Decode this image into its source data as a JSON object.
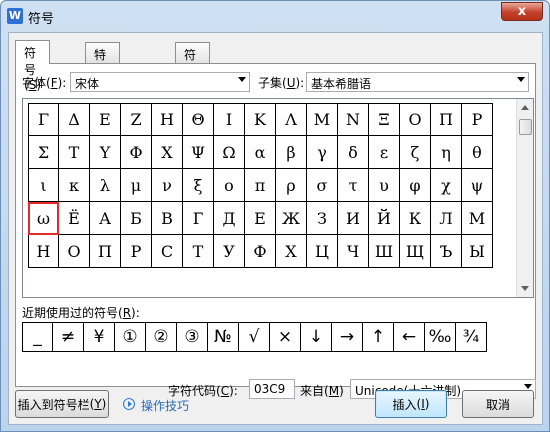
{
  "window": {
    "title": "符号",
    "app_icon_letter": "W",
    "close_label": "x"
  },
  "tabs": [
    {
      "label": "符号",
      "key": "S"
    },
    {
      "label": "特殊字符",
      "key": "P"
    },
    {
      "label": "符号栏",
      "key": "T"
    }
  ],
  "font": {
    "label": "字体",
    "key": "F",
    "value": "宋体"
  },
  "subset": {
    "label": "子集",
    "key": "U",
    "value": "基本希腊语"
  },
  "symbols": [
    [
      "Γ",
      "Δ",
      "Ε",
      "Ζ",
      "Η",
      "Θ",
      "Ι",
      "Κ",
      "Λ",
      "Μ",
      "Ν",
      "Ξ",
      "Ο",
      "Π",
      "Ρ"
    ],
    [
      "Σ",
      "Τ",
      "Υ",
      "Φ",
      "Χ",
      "Ψ",
      "Ω",
      "α",
      "β",
      "γ",
      "δ",
      "ε",
      "ζ",
      "η",
      "θ"
    ],
    [
      "ι",
      "κ",
      "λ",
      "μ",
      "ν",
      "ξ",
      "ο",
      "π",
      "ρ",
      "σ",
      "τ",
      "υ",
      "φ",
      "χ",
      "ψ"
    ],
    [
      "ω",
      "Ё",
      "А",
      "Б",
      "В",
      "Г",
      "Д",
      "Е",
      "Ж",
      "З",
      "И",
      "Й",
      "К",
      "Л",
      "М"
    ],
    [
      "Н",
      "О",
      "П",
      "Р",
      "С",
      "Т",
      "У",
      "Ф",
      "Х",
      "Ц",
      "Ч",
      "Ш",
      "Щ",
      "Ъ",
      "Ы"
    ]
  ],
  "selected_symbol": "ω",
  "recent": {
    "label": "近期使用过的符号",
    "key": "R",
    "items": [
      "_",
      "≠",
      "¥",
      "①",
      "②",
      "③",
      "№",
      "√",
      "×",
      "↓",
      "→",
      "↑",
      "←",
      "‰",
      "¾"
    ]
  },
  "char_code": {
    "label": "字符代码",
    "key": "C",
    "value": "03C9"
  },
  "from": {
    "label": "来自",
    "key": "M",
    "value": "Unicode(十六进制)"
  },
  "buttons": {
    "insert_to_bar": {
      "label": "插入到符号栏",
      "key": "Y"
    },
    "tips": "操作技巧",
    "insert": {
      "label": "插入",
      "key": "I"
    },
    "cancel": "取消"
  }
}
